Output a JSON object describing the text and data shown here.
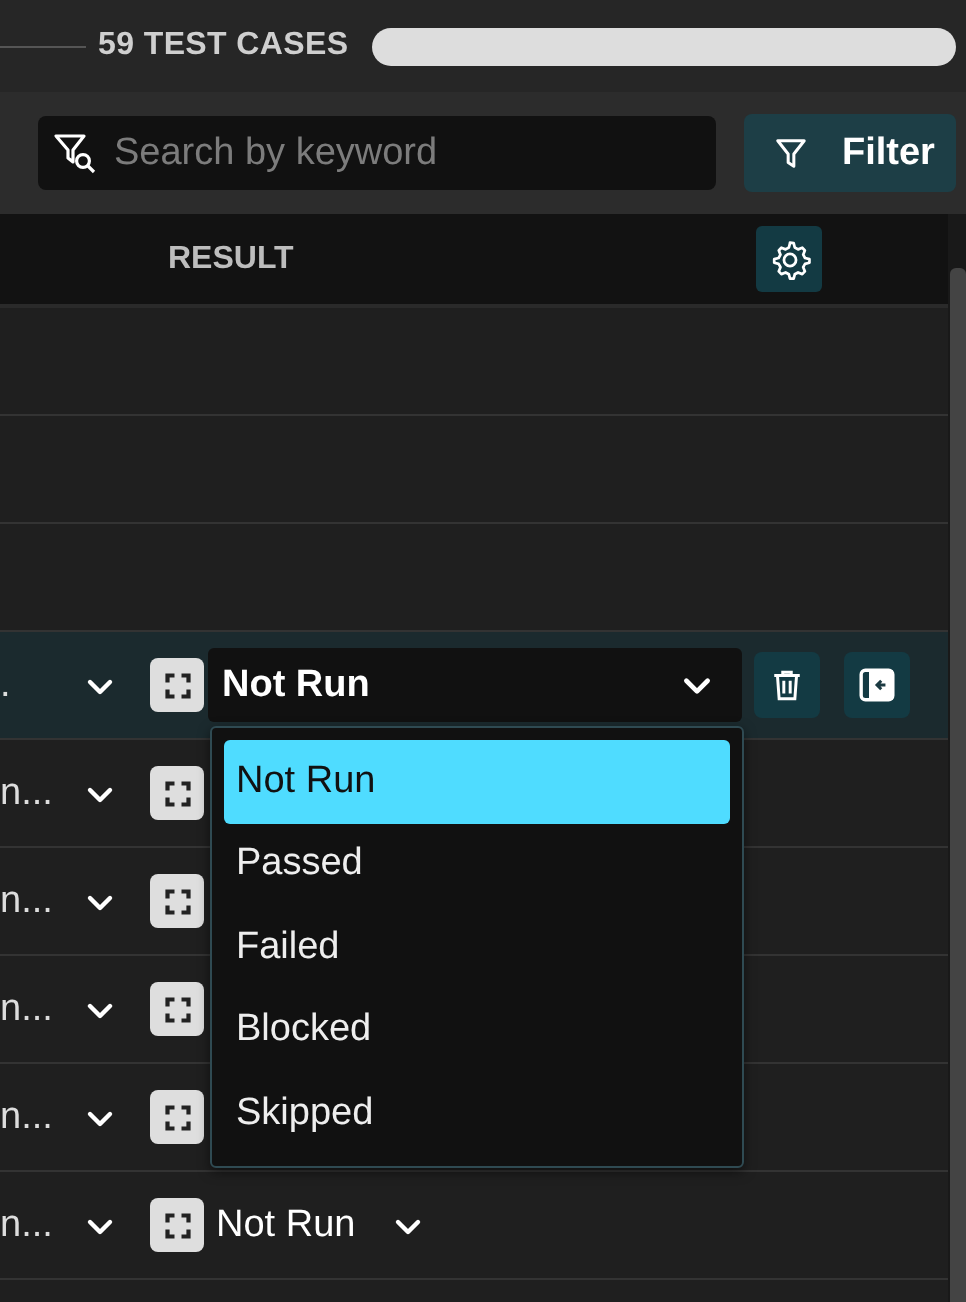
{
  "summary": {
    "count_label": "59 TEST CASES",
    "progress": {
      "level": 0
    }
  },
  "search": {
    "placeholder": "Search by keyword"
  },
  "filter_button": {
    "label": "Filter"
  },
  "table": {
    "columns": [
      {
        "label": "RESULT"
      }
    ],
    "rows": [
      {
        "kind": "empty"
      },
      {
        "kind": "empty"
      },
      {
        "kind": "empty"
      },
      {
        "kind": "case",
        "name": ".",
        "selected": true,
        "result": "Not Run",
        "menu": {
          "options": [
            {
              "label": "Not Run",
              "selected": true
            },
            {
              "label": "Passed",
              "selected": false
            },
            {
              "label": "Failed",
              "selected": false
            },
            {
              "label": "Blocked",
              "selected": false
            },
            {
              "label": "Skipped",
              "selected": false
            }
          ]
        }
      },
      {
        "kind": "case",
        "name": "n...",
        "selected": false
      },
      {
        "kind": "case",
        "name": "n...",
        "selected": false
      },
      {
        "kind": "case",
        "name": "n...",
        "selected": false
      },
      {
        "kind": "case",
        "name": "n...",
        "selected": false
      },
      {
        "kind": "case",
        "name": "n...",
        "selected": false,
        "result": "Not Run"
      },
      {
        "kind": "empty"
      }
    ]
  }
}
